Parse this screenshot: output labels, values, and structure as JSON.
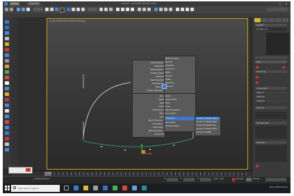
{
  "window": {
    "title": "Untitled - Autodesk 3ds Max 2020",
    "controls": [
      "–",
      "□",
      "✕"
    ],
    "file_tabs": [
      "Untitled",
      "Customize"
    ]
  },
  "viewport": {
    "label": "[+] [Front] [Standard] [Default Shading]",
    "border_color": "#c9a21c"
  },
  "quad_menu": {
    "left_items": [
      "Isolate Selection",
      "Unfreeze All",
      "Freeze Selection",
      "Unhide by Name",
      "Unhide All",
      "Hide Unselected",
      "Hide Selection",
      "State Sets",
      "Manage State Sets..."
    ],
    "right_items": [
      "Reset Transform",
      "Reverse",
      "Subdivide",
      "Convert to:",
      "Refine",
      "Connect",
      "Delete",
      "Make First",
      "Top-level"
    ],
    "lower_left": [
      "Move",
      "Rotate",
      "Scale",
      "Select",
      "Select Similar",
      "Place",
      "Clone",
      "Object Properties...",
      "Curve Editor...",
      "Dope Sheet...",
      "Wire Parameters...",
      "Convert To:"
    ],
    "submenu": {
      "highlighted": "Convert to Editable Spline",
      "items": [
        "Convert to Editable Mesh",
        "Convert to Editable Poly",
        "Convert to Editable Patch",
        "Convert to NURBS"
      ]
    },
    "highlight_color": "#3b78c9"
  },
  "command_panel": {
    "header": "Line001",
    "rollouts": [
      "Modifier List",
      "Line",
      "Rendering",
      "Interpolation",
      "Selection",
      "Soft Selection",
      "Geometry"
    ],
    "fields": [
      "Steps: 6",
      "Optimize",
      "Adaptive"
    ]
  },
  "timeline": {
    "frame": "0 / 100"
  },
  "status": {
    "selected": "1 Shape Selected",
    "x": "X:",
    "y": "Y:",
    "z": "Z:",
    "grid": "Grid = 10.0",
    "auto_key": "Auto Key",
    "set_key": "Set Key"
  },
  "taskbar": {
    "search_placeholder": "Type here to search",
    "time": "10:13",
    "date": "2021-04-11"
  },
  "colors": {
    "curve": "#cfcfcf",
    "baseline": "#3fd4b0",
    "gizmo_x": "#d63b3b",
    "gizmo_y": "#37c24a"
  },
  "icons": [
    "windows-start-icon",
    "search-icon",
    "task-view-icon",
    "explorer-icon",
    "browser-icon",
    "max-app-icon",
    "gizmo-icon"
  ]
}
